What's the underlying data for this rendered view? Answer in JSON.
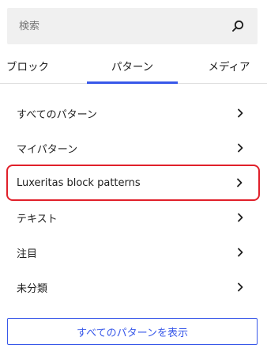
{
  "search": {
    "placeholder": "検索",
    "icon": "search-icon"
  },
  "tabs": [
    {
      "label": "ブロック",
      "active": false
    },
    {
      "label": "パターン",
      "active": true
    },
    {
      "label": "メディア",
      "active": false
    }
  ],
  "categories": [
    {
      "label": "すべてのパターン",
      "icon": "chevron-right-icon"
    },
    {
      "label": "マイパターン",
      "icon": "chevron-right-icon"
    },
    {
      "label": "Luxeritas block patterns",
      "icon": "chevron-right-icon",
      "highlighted": true
    },
    {
      "label": "テキスト",
      "icon": "chevron-right-icon"
    },
    {
      "label": "注目",
      "icon": "chevron-right-icon"
    },
    {
      "label": "未分類",
      "icon": "chevron-right-icon"
    }
  ],
  "show_all_button": {
    "label": "すべてのパターンを表示"
  },
  "colors": {
    "accent": "#3858e9",
    "highlight_border": "#e0202a",
    "search_bg": "#f0f0f0"
  }
}
